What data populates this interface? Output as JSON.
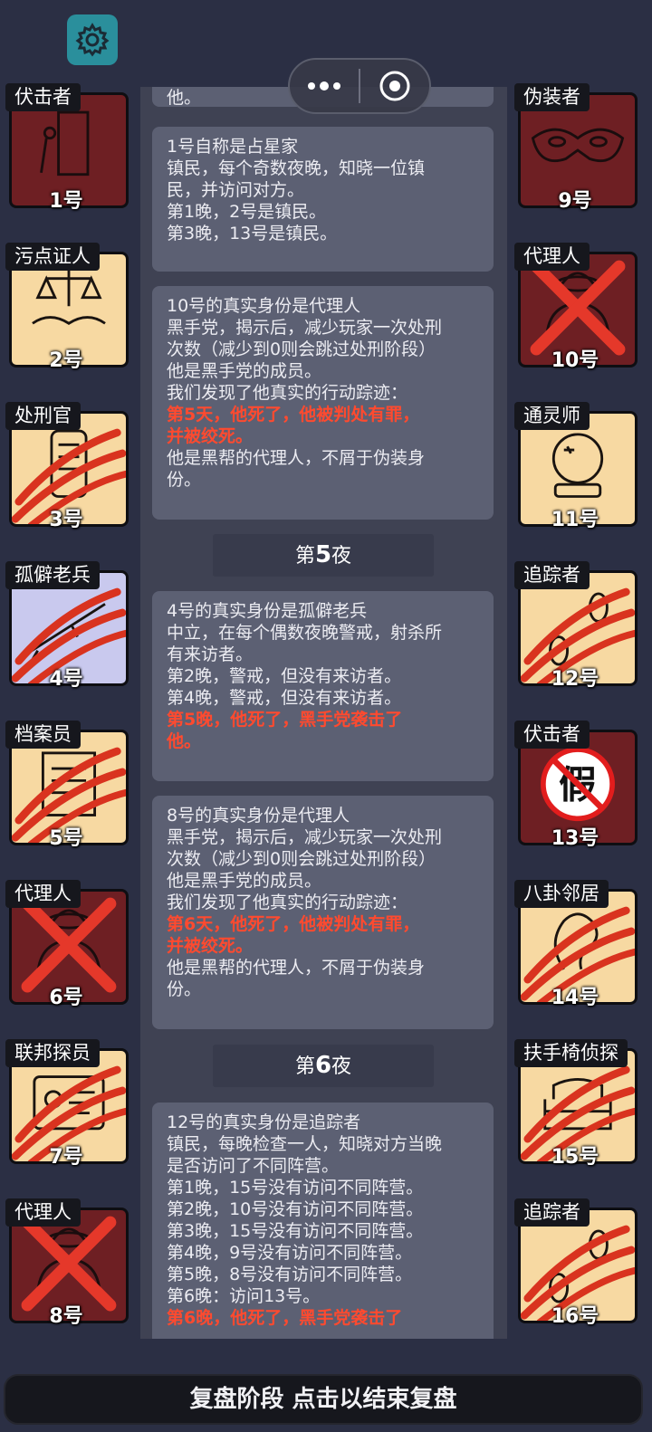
{
  "title_bar": {
    "settings_icon": "gear-icon",
    "menu_icon": "more-dots-icon",
    "close_icon": "target-circle-icon"
  },
  "players_left": [
    {
      "role": "伏击者",
      "num": "1号",
      "theme": "mafia",
      "icon": "door-knife-icon",
      "status": "alive"
    },
    {
      "role": "污点证人",
      "num": "2号",
      "theme": "town",
      "icon": "scales-handshake-icon",
      "status": "alive"
    },
    {
      "role": "处刑官",
      "num": "3号",
      "theme": "town",
      "icon": "scroll-icon",
      "status": "dead"
    },
    {
      "role": "孤僻老兵",
      "num": "4号",
      "theme": "neutral",
      "icon": "rifle-icon",
      "status": "dead"
    },
    {
      "role": "档案员",
      "num": "5号",
      "theme": "town",
      "icon": "document-icon",
      "status": "dead"
    },
    {
      "role": "代理人",
      "num": "6号",
      "theme": "mafia",
      "icon": "agent-icon",
      "status": "executed"
    },
    {
      "role": "联邦探员",
      "num": "7号",
      "theme": "town",
      "icon": "badge-icon",
      "status": "dead"
    },
    {
      "role": "代理人",
      "num": "8号",
      "theme": "mafia",
      "icon": "agent-icon",
      "status": "executed"
    }
  ],
  "players_right": [
    {
      "role": "伪装者",
      "num": "9号",
      "theme": "mafia",
      "icon": "mask-icon",
      "status": "alive"
    },
    {
      "role": "代理人",
      "num": "10号",
      "theme": "mafia",
      "icon": "agent-icon",
      "status": "executed"
    },
    {
      "role": "通灵师",
      "num": "11号",
      "theme": "town",
      "icon": "crystal-ball-icon",
      "status": "alive"
    },
    {
      "role": "追踪者",
      "num": "12号",
      "theme": "town",
      "icon": "footprints-icon",
      "status": "dead"
    },
    {
      "role": "伏击者",
      "num": "13号",
      "theme": "mafia",
      "icon": "fake-stamp-icon",
      "status": "alive"
    },
    {
      "role": "八卦邻居",
      "num": "14号",
      "theme": "town",
      "icon": "ear-icon",
      "status": "dead"
    },
    {
      "role": "扶手椅侦探",
      "num": "15号",
      "theme": "town",
      "icon": "armchair-icon",
      "status": "dead"
    },
    {
      "role": "追踪者",
      "num": "16号",
      "theme": "town",
      "icon": "footprints-icon",
      "status": "dead"
    }
  ],
  "log": {
    "partial_top": "他。",
    "entry1": [
      "1号自称是占星家",
      "镇民，每个奇数夜晚，知晓一位镇",
      "民，并访问对方。",
      "第1晚，2号是镇民。",
      "第3晚，13号是镇民。"
    ],
    "entry2": [
      "10号的真实身份是代理人",
      "黑手党，揭示后，减少玩家一次处刑",
      "次数（减少到0则会跳过处刑阶段）",
      "他是黑手党的成员。",
      "我们发现了他真实的行动踪迹：",
      "第5天，他死了，他被判处有罪，",
      "并被绞死。",
      "他是黑帮的代理人，不屑于伪装身",
      "份。"
    ],
    "night5_prefix": "第",
    "night5_num": "5",
    "night5_suffix": "夜",
    "entry3": [
      "4号的真实身份是孤僻老兵",
      "中立，在每个偶数夜晚警戒，射杀所",
      "有来访者。",
      "第2晚，警戒，但没有来访者。",
      "第4晚，警戒，但没有来访者。",
      "第5晚，他死了，黑手党袭击了",
      "他。"
    ],
    "entry4": [
      "8号的真实身份是代理人",
      "黑手党，揭示后，减少玩家一次处刑",
      "次数（减少到0则会跳过处刑阶段）",
      "他是黑手党的成员。",
      "我们发现了他真实的行动踪迹：",
      "第6天，他死了，他被判处有罪，",
      "并被绞死。",
      "他是黑帮的代理人，不屑于伪装身",
      "份。"
    ],
    "night6_prefix": "第",
    "night6_num": "6",
    "night6_suffix": "夜",
    "entry5": [
      "12号的真实身份是追踪者",
      "镇民，每晚检查一人，知晓对方当晚",
      "是否访问了不同阵营。",
      "第1晚，15号没有访问不同阵营。",
      "第2晚，10号没有访问不同阵营。",
      "第3晚，15号没有访问不同阵营。",
      "第4晚，9号没有访问不同阵营。",
      "第5晚，8号没有访问不同阵营。",
      "第6晚：访问13号。",
      "第6晚，他死了，黑手党袭击了"
    ]
  },
  "bottom_bar": {
    "label": "复盘阶段 点击以结束复盘"
  },
  "colors": {
    "background": "#2b2f44",
    "town_card": "#f7d9a2",
    "mafia_card": "#6e1f23",
    "neutral_card": "#c9c9ee",
    "death_text": "#ff4a2f",
    "claw": "#d9331f",
    "cross": "#e5382a"
  }
}
